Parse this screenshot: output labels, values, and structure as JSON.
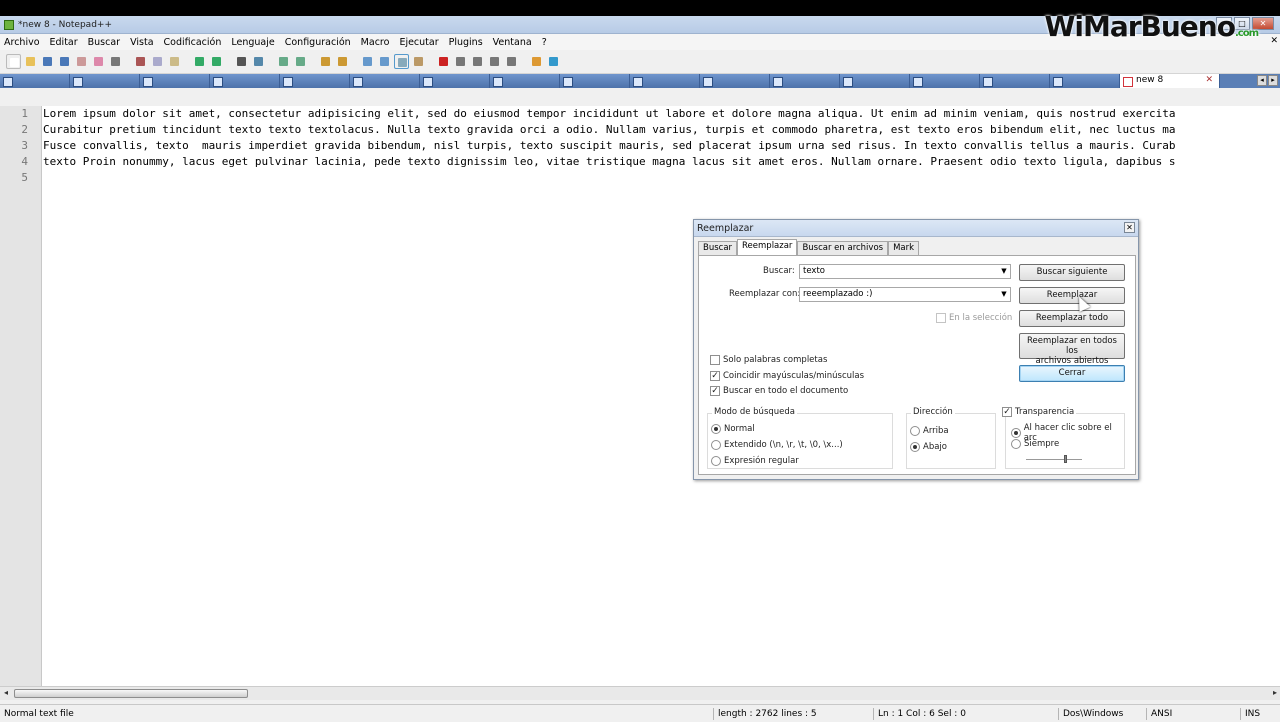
{
  "window": {
    "title": "*new  8 - Notepad++"
  },
  "menu": [
    {
      "label": "Archivo"
    },
    {
      "label": "Editar"
    },
    {
      "label": "Buscar"
    },
    {
      "label": "Vista"
    },
    {
      "label": "Codificación"
    },
    {
      "label": "Lenguaje"
    },
    {
      "label": "Configuración"
    },
    {
      "label": "Macro"
    },
    {
      "label": "Ejecutar"
    },
    {
      "label": "Plugins"
    },
    {
      "label": "Ventana"
    },
    {
      "label": "?"
    }
  ],
  "watermark": {
    "name": "WiMarBueno",
    "suffix": ".com"
  },
  "tabs": {
    "active_label": "new  8",
    "close_glyph": "✕"
  },
  "editor": {
    "line_numbers": [
      "1",
      "2",
      "3",
      "4",
      "5"
    ],
    "lines": [
      "Lorem ipsum dolor sit amet, consectetur adipisicing elit, sed do eiusmod tempor incididunt ut labore et dolore magna aliqua. Ut enim ad minim veniam, quis nostrud exercita",
      "Curabitur pretium tincidunt texto texto textolacus. Nulla texto gravida orci a odio. Nullam varius, turpis et commodo pharetra, est texto eros bibendum elit, nec luctus ma",
      "Fusce convallis, texto  mauris imperdiet gravida bibendum, nisl turpis, texto suscipit mauris, sed placerat ipsum urna sed risus. In texto convallis tellus a mauris. Curab",
      "texto Proin nonummy, lacus eget pulvinar lacinia, pede texto dignissim leo, vitae tristique magna lacus sit amet eros. Nullam ornare. Praesent odio texto ligula, dapibus s",
      ""
    ]
  },
  "status": {
    "file_type": "Normal text file",
    "length": "length : 2762    lines : 5",
    "position": "Ln : 1    Col : 6    Sel : 0",
    "eol": "Dos\\Windows",
    "encoding": "ANSI",
    "mode": "INS"
  },
  "dialog": {
    "title": "Reemplazar",
    "tabs": [
      "Buscar",
      "Reemplazar",
      "Buscar en archivos",
      "Mark"
    ],
    "find_label": "Buscar:",
    "find_value": "texto",
    "replace_label": "Reemplazar con:",
    "replace_value": "reeemplazado :)",
    "in_selection": "En la selección",
    "buttons": {
      "find_next": "Buscar siguiente",
      "replace": "Reemplazar",
      "replace_all": "Reemplazar todo",
      "replace_all_open_1": "Reemplazar en todos los",
      "replace_all_open_2": "archivos abiertos",
      "close": "Cerrar"
    },
    "options": {
      "whole_word": "Solo palabras completas",
      "match_case": "Coincidir mayúsculas/minúsculas",
      "wrap": "Buscar en todo el documento"
    },
    "search_mode": {
      "title": "Modo de búsqueda",
      "normal": "Normal",
      "extended": "Extendido (\\n, \\r, \\t, \\0, \\x...)",
      "regex": "Expresión regular"
    },
    "direction": {
      "title": "Dirección",
      "up": "Arriba",
      "down": "Abajo"
    },
    "transparency": {
      "title": "Transparencia",
      "on_click": "Al hacer clic sobre el arc",
      "always": "Siempre"
    }
  }
}
